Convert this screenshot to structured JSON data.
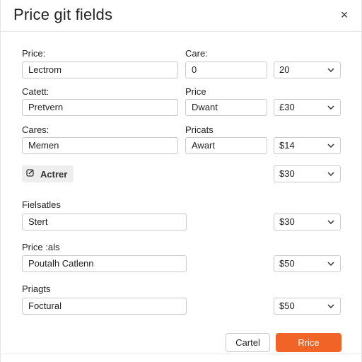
{
  "dialog": {
    "title": "Price git fields",
    "close_glyph": "×"
  },
  "rows": [
    {
      "left_label": "Price:",
      "left_value": "Lectrom",
      "mid_label": "Care:",
      "mid_value": "0",
      "select_value": "20"
    },
    {
      "left_label": "Catett:",
      "left_value": "Pretvern",
      "mid_label": "Price",
      "mid_value": "Dwant",
      "select_value": "£30"
    },
    {
      "left_label": "Cares:",
      "left_value": "Memen",
      "mid_label": "Pricats",
      "mid_value": "Awart",
      "select_value": "$14"
    }
  ],
  "action_tag": {
    "label": "Actrer",
    "icon": "edit-icon"
  },
  "action_select_value": "$30",
  "lower_rows": [
    {
      "label": "Fielsatles",
      "value": "Stert",
      "select_value": "$30"
    },
    {
      "label": "Price :als",
      "value": "Poutalh Catlenn",
      "select_value": "$50"
    },
    {
      "label": "Priagts",
      "value": "Foctural",
      "select_value": "$50"
    }
  ],
  "footer": {
    "cancel_label": "Cartel",
    "primary_label": "Rrice"
  },
  "colors": {
    "primary": "#f06428",
    "border": "#c9c9c9",
    "tag_bg": "#eeeeee"
  }
}
